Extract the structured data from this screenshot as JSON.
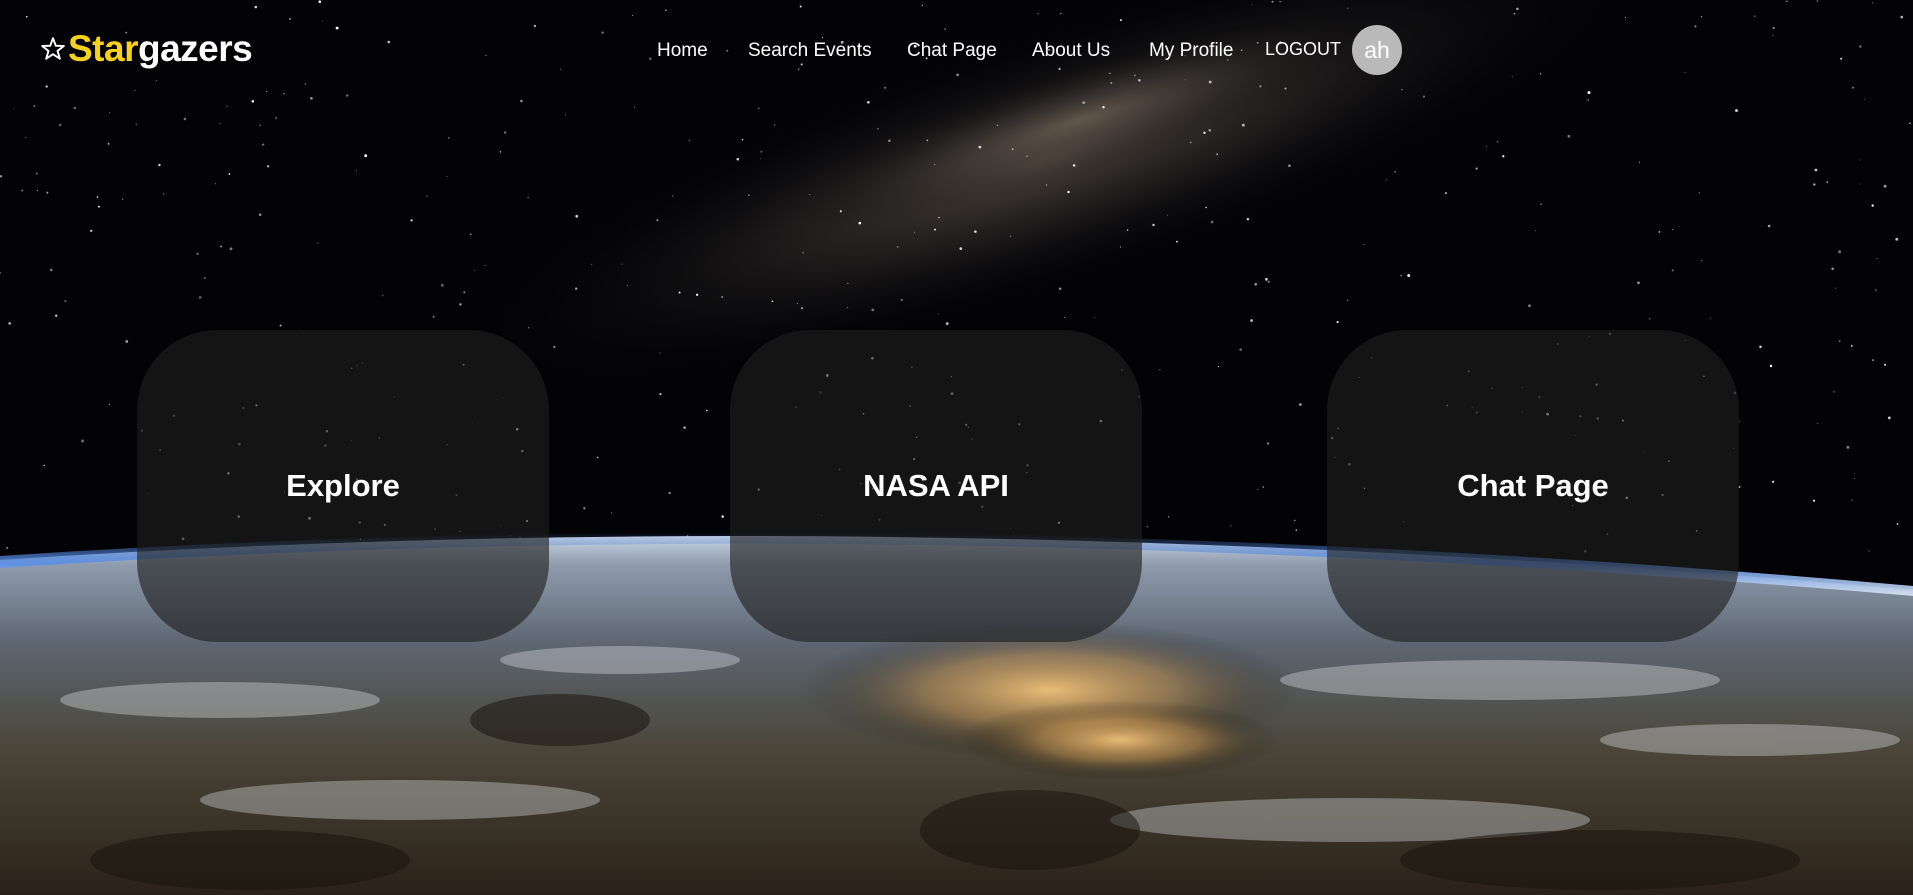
{
  "brand": {
    "prefix": "Star",
    "suffix": "gazers",
    "icon": "star-outline-icon",
    "prefix_color": "#f7d21c",
    "suffix_color": "#ffffff"
  },
  "nav": {
    "items": [
      {
        "label": "Home"
      },
      {
        "label": "Search Events"
      },
      {
        "label": "Chat Page"
      },
      {
        "label": "About Us"
      },
      {
        "label": "My Profile"
      }
    ],
    "logout_label": "LOGOUT",
    "avatar_initials": "ah"
  },
  "cards": [
    {
      "label": "Explore"
    },
    {
      "label": "NASA API"
    },
    {
      "label": "Chat Page"
    }
  ],
  "background": {
    "description_icon": "space-earth-background"
  }
}
